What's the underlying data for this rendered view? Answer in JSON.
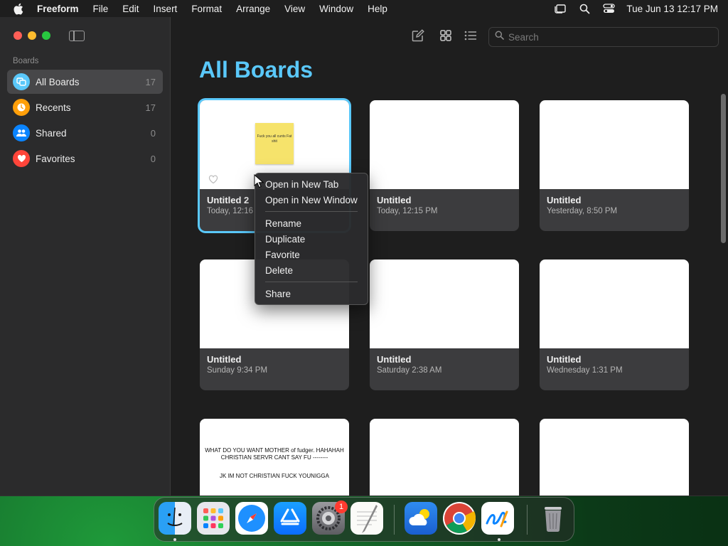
{
  "menubar": {
    "app_name": "Freeform",
    "items": [
      "File",
      "Edit",
      "Insert",
      "Format",
      "Arrange",
      "View",
      "Window",
      "Help"
    ],
    "clock": "Tue Jun 13  12:17 PM"
  },
  "sidebar": {
    "heading": "Boards",
    "items": [
      {
        "label": "All Boards",
        "count": "17",
        "icon": "boards-icon",
        "color": "#5ac8fa"
      },
      {
        "label": "Recents",
        "count": "17",
        "icon": "clock-icon",
        "color": "#ff9f0a"
      },
      {
        "label": "Shared",
        "count": "0",
        "icon": "people-icon",
        "color": "#0a84ff"
      },
      {
        "label": "Favorites",
        "count": "0",
        "icon": "heart-icon",
        "color": "#ff453a"
      }
    ]
  },
  "search": {
    "placeholder": "Search"
  },
  "page": {
    "title": "All Boards"
  },
  "boards": [
    {
      "title": "Untitled 2",
      "date": "Today, 12:16"
    },
    {
      "title": "Untitled",
      "date": "Today, 12:15 PM"
    },
    {
      "title": "Untitled",
      "date": "Yesterday, 8:50 PM"
    },
    {
      "title": "Untitled",
      "date": "Sunday 9:34 PM"
    },
    {
      "title": "Untitled",
      "date": "Saturday 2:38 AM"
    },
    {
      "title": "Untitled",
      "date": "Wednesday 1:31 PM"
    }
  ],
  "board_thumbs": {
    "sticky_text": "Fuck you all cunts Fat shit",
    "line_one": "WHAT DO YOU WANT MOTHER of fudger. HAHAHAH CHRISTIAN SERVR CANT SAY FU --------",
    "line_two": "JK IM NOT CHRISTIAN FUCK YOUNIGGA"
  },
  "context_menu": {
    "open_new_tab": "Open in New Tab",
    "open_new_window": "Open in New Window",
    "rename": "Rename",
    "duplicate": "Duplicate",
    "favorite": "Favorite",
    "delete": "Delete",
    "share": "Share"
  },
  "dock": {
    "apps": [
      "Finder",
      "Launchpad",
      "Safari",
      "App Store",
      "System Settings",
      "TextEdit",
      "iCloud",
      "Chrome",
      "Freeform",
      "Trash"
    ],
    "settings_badge": "1"
  }
}
